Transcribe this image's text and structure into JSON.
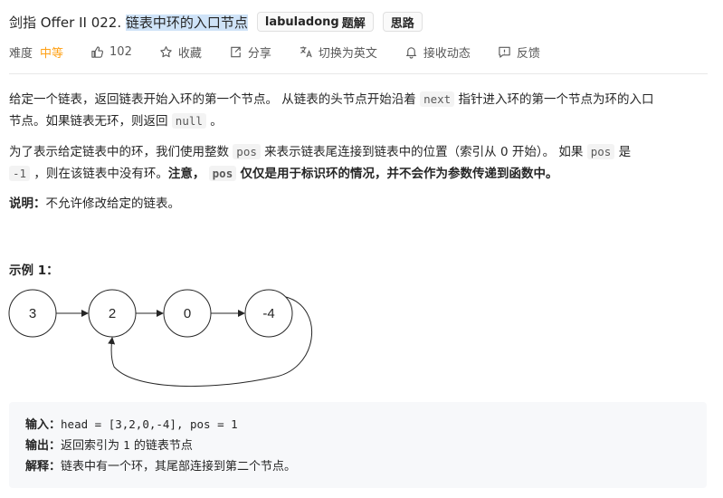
{
  "header": {
    "title_prefix": "剑指 Offer II 022. ",
    "title_highlight": "链表中环的入口节点",
    "tag_author": "labuladong",
    "tag_author_suffix": "题解",
    "tag_thoughts": "思路"
  },
  "meta": {
    "difficulty_label": "难度",
    "difficulty_value": "中等",
    "like_count": "102",
    "favorite_label": "收藏",
    "share_label": "分享",
    "translate_label": "切换为英文",
    "subscribe_label": "接收动态",
    "feedback_label": "反馈"
  },
  "description": {
    "p1_a": "给定一个链表，返回链表开始入环的第一个节点。 从链表的头节点开始沿着",
    "p1_code": "next",
    "p1_b": "指针进入环的第一个节点为环的入口",
    "p1_c": "节点。如果链表无环，则返回",
    "p1_code2": "null",
    "p1_d": "。",
    "p2_a": "为了表示给定链表中的环，我们使用整数",
    "p2_code": "pos",
    "p2_b": "来表示链表尾连接到链表中的位置（索引从 0 开始）。 如果",
    "p2_code2": "pos",
    "p2_c": "是",
    "p2_code3": "-1",
    "p2_d": "，则在该链表中没有环。",
    "p2_bold1": "注意，",
    "p2_code4": "pos",
    "p2_bold2": "仅仅是用于标识环的情况，并不会作为参数传递到函数中。",
    "p3_bold": "说明：",
    "p3_text": "不允许修改给定的链表。"
  },
  "example": {
    "title": "示例 1：",
    "nodes": [
      "3",
      "2",
      "0",
      "-4"
    ],
    "input_label": "输入：",
    "input_value": "head = [3,2,0,-4], pos = 1",
    "output_label": "输出：",
    "output_a": "返回索引为",
    "output_code": "1",
    "output_b": "的链表节点",
    "explain_label": "解释：",
    "explain_value": "链表中有一个环，其尾部连接到第二个节点。"
  },
  "colors": {
    "difficulty": "#ffa116",
    "highlight": "#cfe3f8",
    "example_bg": "#f7f8fa"
  }
}
